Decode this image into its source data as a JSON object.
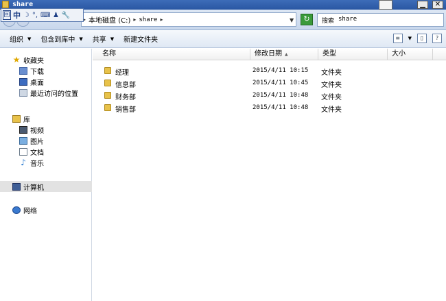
{
  "window": {
    "title": "share",
    "buttons": {
      "minimize": "▁",
      "close": "✕"
    }
  },
  "ime": {
    "items": [
      "中",
      "☽",
      "°,",
      "⌨",
      "♟",
      "🔧"
    ],
    "box": "回"
  },
  "address": {
    "crumbs": [
      "本地磁盘 (C:)",
      "share"
    ],
    "separator": "▸",
    "search_label": "搜索",
    "search_target": "share"
  },
  "toolbar": {
    "organize": "组织",
    "include_library": "包含到库中",
    "share": "共享",
    "new_folder": "新建文件夹"
  },
  "navpane": {
    "favorites": {
      "label": "收藏夹",
      "items": [
        "下载",
        "桌面",
        "最近访问的位置"
      ]
    },
    "libraries": {
      "label": "库",
      "items": [
        "视频",
        "图片",
        "文档",
        "音乐"
      ]
    },
    "computer": "计算机",
    "network": "网络"
  },
  "columns": {
    "name": "名称",
    "date": "修改日期",
    "type": "类型",
    "size": "大小"
  },
  "files": [
    {
      "name": "经理",
      "date": "2015/4/11 10:15",
      "type": "文件夹"
    },
    {
      "name": "信息部",
      "date": "2015/4/11 10:45",
      "type": "文件夹"
    },
    {
      "name": "财务部",
      "date": "2015/4/11 10:48",
      "type": "文件夹"
    },
    {
      "name": "销售部",
      "date": "2015/4/11 10:48",
      "type": "文件夹"
    }
  ]
}
